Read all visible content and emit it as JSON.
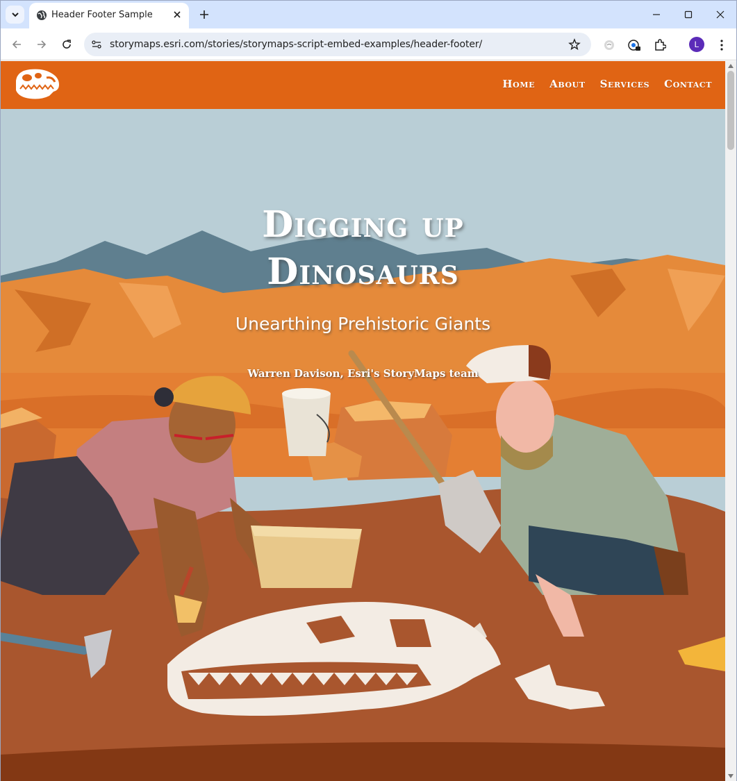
{
  "browser": {
    "tab_title": "Header Footer Sample",
    "url": "storymaps.esri.com/stories/storymaps-script-embed-examples/header-footer/",
    "profile_initial": "L",
    "icons": [
      "tab-search-icon",
      "globe-icon",
      "close-icon",
      "plus-icon",
      "minimize-icon",
      "maximize-icon",
      "close-window-icon",
      "back-arrow-icon",
      "forward-arrow-icon",
      "reload-icon",
      "site-info-icon",
      "star-icon",
      "extension-icon",
      "password-icon",
      "puzzle-icon",
      "more-menu-icon"
    ]
  },
  "site": {
    "nav": [
      "Home",
      "About",
      "Services",
      "Contact"
    ],
    "logo_icon": "dinosaur-skull-icon"
  },
  "hero": {
    "title_line1": "Digging up",
    "title_line2": "Dinosaurs",
    "subtitle": "Unearthing Prehistoric Giants",
    "author": "Warren Davison, Esri's StoryMaps team"
  },
  "colors": {
    "header_orange": "#e06414",
    "sky": "#b9ced6",
    "sand": "#e58a3a",
    "dirt": "#a9562e"
  }
}
